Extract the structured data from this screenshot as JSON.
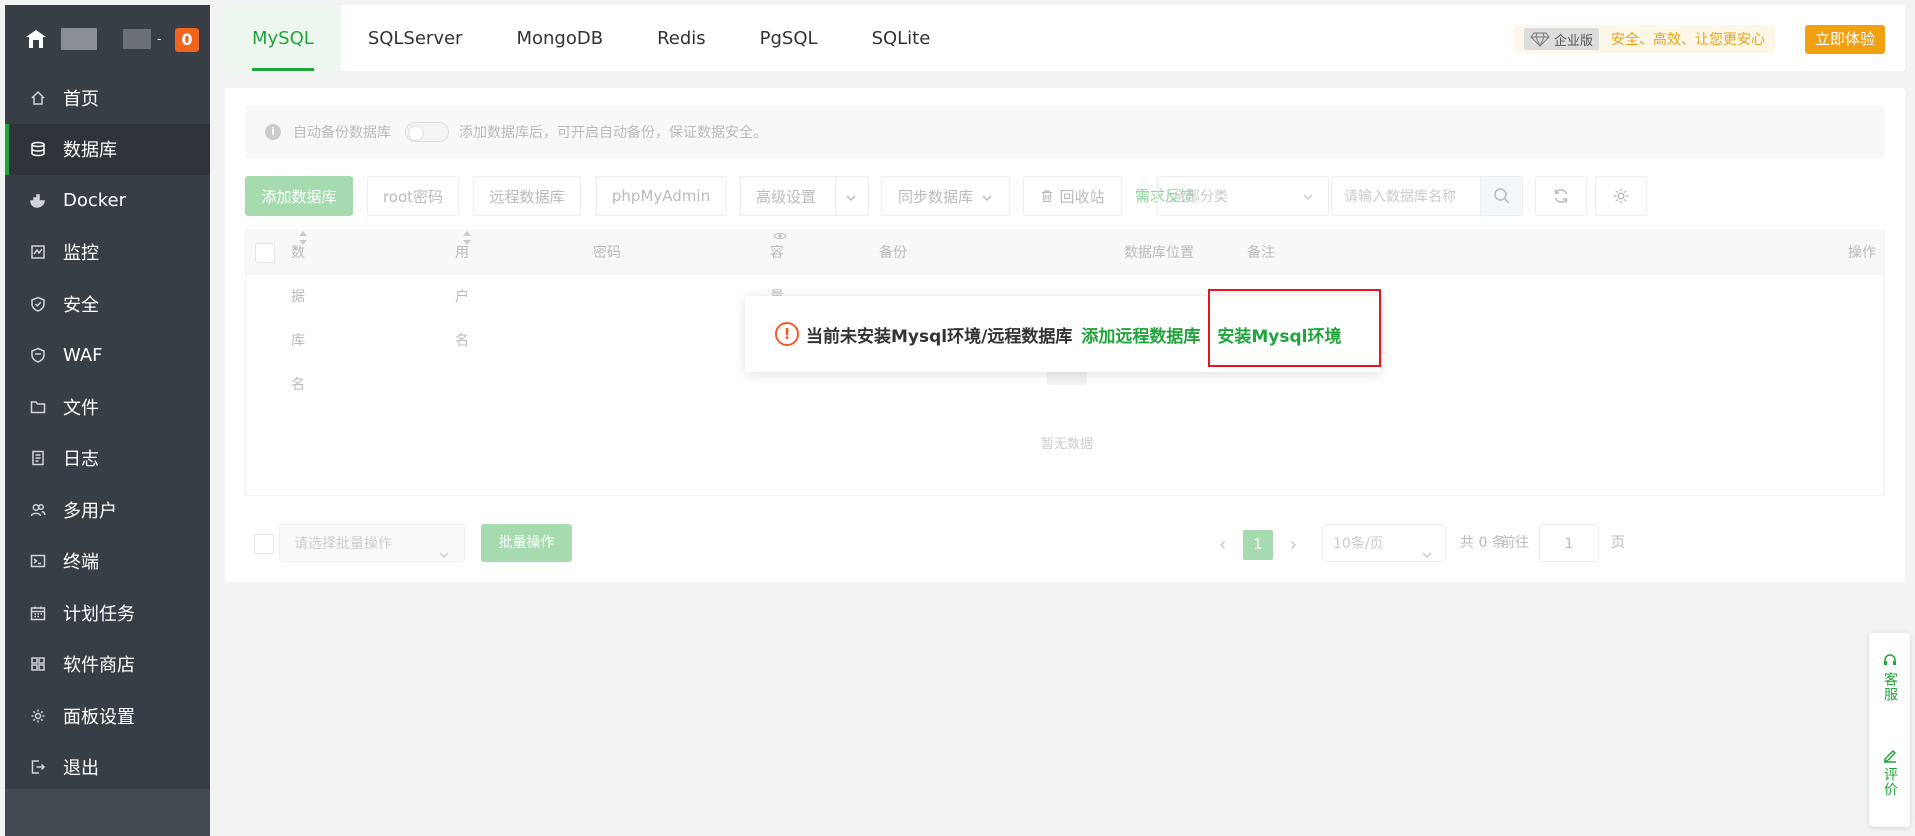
{
  "sidebar": {
    "badge": "0",
    "menu": [
      {
        "label": "首页",
        "icon": "home-icon",
        "active": false
      },
      {
        "label": "数据库",
        "icon": "database-icon",
        "active": true
      },
      {
        "label": "Docker",
        "icon": "docker-icon",
        "active": false
      },
      {
        "label": "监控",
        "icon": "monitor-icon",
        "active": false
      },
      {
        "label": "安全",
        "icon": "shield-icon",
        "active": false
      },
      {
        "label": "WAF",
        "icon": "waf-shield-icon",
        "active": false
      },
      {
        "label": "文件",
        "icon": "folder-icon",
        "active": false
      },
      {
        "label": "日志",
        "icon": "log-icon",
        "active": false
      },
      {
        "label": "多用户",
        "icon": "users-icon",
        "active": false
      },
      {
        "label": "终端",
        "icon": "terminal-icon",
        "active": false
      },
      {
        "label": "计划任务",
        "icon": "calendar-icon",
        "active": false
      },
      {
        "label": "软件商店",
        "icon": "apps-icon",
        "active": false
      },
      {
        "label": "面板设置",
        "icon": "gear-icon",
        "active": false
      },
      {
        "label": "退出",
        "icon": "logout-icon",
        "active": false
      }
    ]
  },
  "tabs": [
    {
      "label": "MySQL",
      "active": true
    },
    {
      "label": "SQLServer"
    },
    {
      "label": "MongoDB"
    },
    {
      "label": "Redis"
    },
    {
      "label": "PgSQL"
    },
    {
      "label": "SQLite"
    }
  ],
  "enterprise": {
    "tag": "企业版",
    "slogan": "安全、高效、让您更安心",
    "try_button": "立即体验"
  },
  "notice": {
    "label": "自动备份数据库",
    "hint": "添加数据库后，可开启自动备份，保证数据安全。"
  },
  "toolbar": {
    "add_db": "添加数据库",
    "root_pwd": "root密码",
    "remote_db": "远程数据库",
    "phpmyadmin": "phpMyAdmin",
    "advanced": "高级设置",
    "sync_db": "同步数据库",
    "recycle": "回收站",
    "feedback": "需求反馈",
    "category": "全部分类",
    "search_placeholder": "请输入数据库名称"
  },
  "table": {
    "columns": [
      "数据库名",
      "用户名",
      "密码",
      "容量",
      "备份",
      "数据库位置",
      "备注",
      "操作"
    ],
    "empty_text": "暂无数据"
  },
  "popup": {
    "message": "当前未安装Mysql环境/远程数据库",
    "add_remote": "添加远程数据库",
    "install": "安装Mysql环境"
  },
  "footer": {
    "batch_placeholder": "请选择批量操作",
    "batch_button": "批量操作",
    "current_page": "1",
    "page_size": "10条/页",
    "total": "共 0 条",
    "goto_label": "前往",
    "goto_value": "1",
    "page_unit": "页"
  },
  "float_panel": {
    "service": "客服",
    "review": "评价"
  },
  "colors": {
    "accent": "#20a53a",
    "sidebar": "#383e45",
    "warning": "#ef5a2a",
    "highlight": "#e3161f",
    "orange": "#f0a010"
  }
}
